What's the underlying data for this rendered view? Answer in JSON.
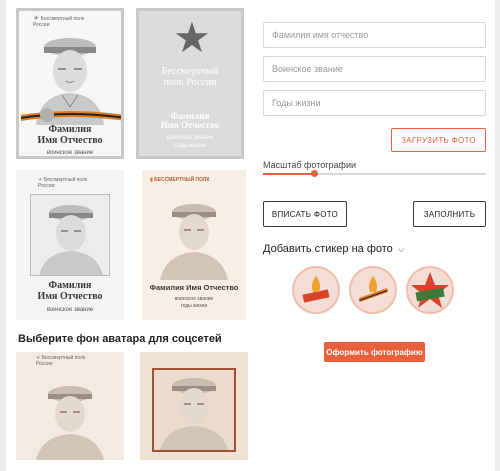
{
  "colors": {
    "accent": "#e8613c",
    "page_bg": "#ececec",
    "card_bg": "#ffffff"
  },
  "templates": {
    "t1": {
      "logo": "Бессмертный полк России",
      "name1": "Фамилия",
      "name2": "Имя Отчество",
      "rank": "воинское звание"
    },
    "t2": {
      "line1": "Бессмертный",
      "line2": "полк России",
      "name1": "Фамилия",
      "name2": "Имя Отчество",
      "rank": "воинское звание",
      "years": "годы жизни"
    },
    "t3": {
      "logo": "Бессмертный полк России",
      "name1": "Фамилия",
      "name2": "Имя Отчество",
      "rank": "воинское звание"
    },
    "t4": {
      "logo": "БЕССМЕРТНЫЙ ПОЛК",
      "name": "Фамилия Имя Отчество",
      "rank": "воинское звание",
      "years": "годы жизни"
    }
  },
  "avatars": {
    "heading": "Выберите фон аватара для соцсетей",
    "a1": {
      "logo": "Бессмертный полк России"
    }
  },
  "form": {
    "fio_placeholder": "Фамилия имя отчество",
    "rank_placeholder": "Воинское звание",
    "years_placeholder": "Годы жизни",
    "upload_label": "ЗАГРУЗИТЬ ФОТО",
    "scale_label": "Масштаб фотографии",
    "scale_value": 0.23,
    "fit_label": "ВПИСАТЬ ФОТО",
    "fill_label": "ЗАПОЛНИТЬ",
    "stickers_label": "Добавить стикер на фото",
    "submit_label": "Оформить фотографию"
  }
}
